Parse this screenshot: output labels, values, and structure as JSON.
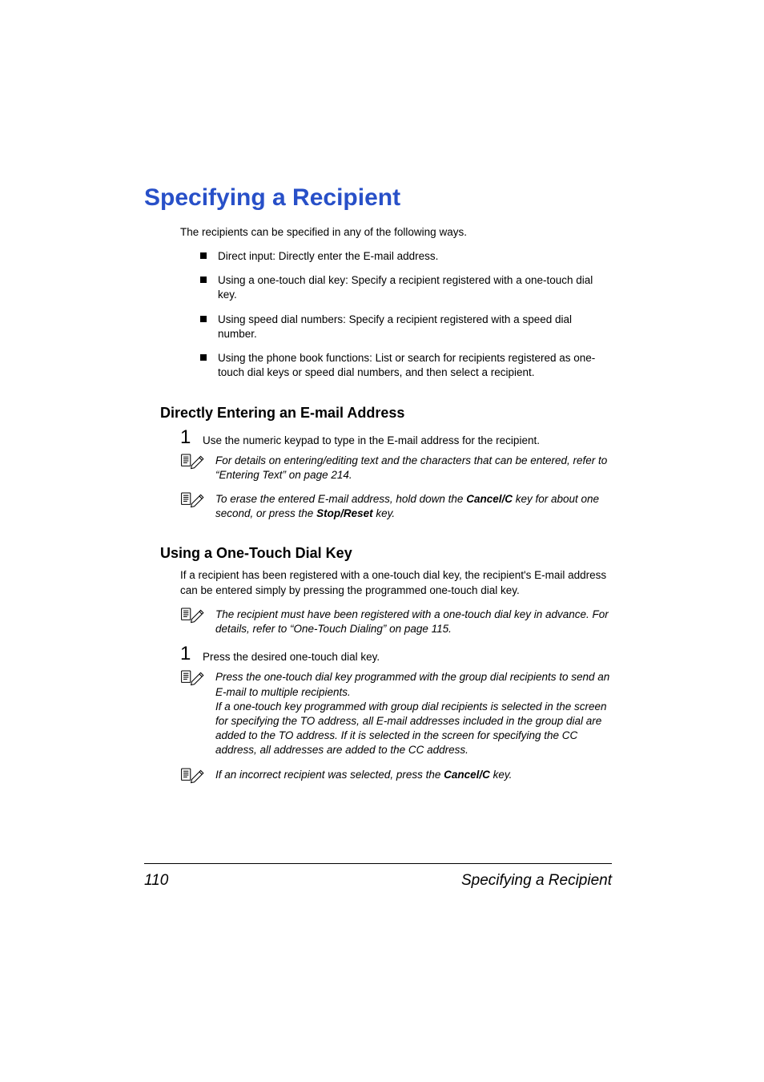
{
  "title": "Specifying a Recipient",
  "intro": "The recipients can be specified in any of the following ways.",
  "bullets": [
    "Direct input: Directly enter the E-mail address.",
    "Using a one-touch dial key: Specify a recipient registered with a one-touch dial key.",
    "Using speed dial numbers: Specify a recipient registered with a speed dial number.",
    "Using the phone book functions: List or search for recipients registered as one-touch dial keys or speed dial numbers, and then select a recipient."
  ],
  "section1": {
    "heading": "Directly Entering an E-mail Address",
    "step1_num": "1",
    "step1_text": "Use the numeric keypad to type in the E-mail address for the recipient.",
    "note1": "For details on entering/editing text and the characters that can be entered, refer to “Entering Text” on page 214.",
    "note2_pre": "To erase the entered E-mail address, hold down the ",
    "note2_b1": "Cancel/C",
    "note2_mid": " key for about one second, or press the ",
    "note2_b2": "Stop/Reset",
    "note2_post": " key."
  },
  "section2": {
    "heading": "Using a One-Touch Dial Key",
    "para": "If a recipient has been registered with a one-touch dial key, the recipient's E-mail address can be entered simply by pressing the programmed one-touch dial key.",
    "note1": "The recipient must have been registered with a one-touch dial key in advance. For details, refer to “One-Touch Dialing” on page 115.",
    "step1_num": "1",
    "step1_text": "Press the desired one-touch dial key.",
    "note2": "Press the one-touch dial key programmed with the group dial recipients to send an E-mail to multiple recipients.\nIf a one-touch key programmed with group dial recipients is selected in the screen for specifying the TO address, all E-mail addresses included in the group dial are added to the TO address. If it is selected in the screen for specifying the CC address, all addresses are added to the CC address.",
    "note3_pre": "If an incorrect recipient was selected, press the ",
    "note3_b1": "Cancel/C",
    "note3_post": " key."
  },
  "footer": {
    "page": "110",
    "label": "Specifying a Recipient"
  }
}
